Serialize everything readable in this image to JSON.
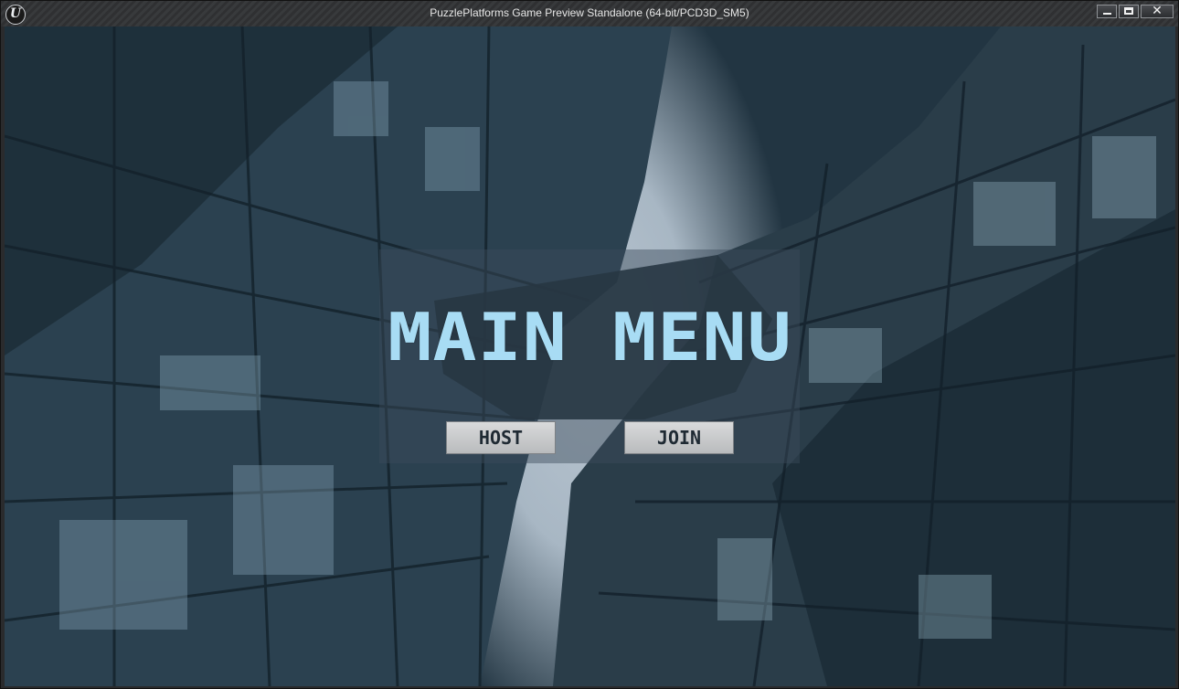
{
  "window": {
    "title": "PuzzlePlatforms Game Preview Standalone (64-bit/PCD3D_SM5)",
    "logo_text": "U",
    "minimize_icon": "minimize-icon",
    "maximize_icon": "maximize-icon",
    "close_glyph": "✕"
  },
  "menu": {
    "title": "MAIN MENU",
    "host_label": "HOST",
    "join_label": "JOIN"
  },
  "colors": {
    "title_text": "#a8dcf4",
    "panel": "rgba(60,75,90,0.45)",
    "button": "#c8cacc"
  }
}
